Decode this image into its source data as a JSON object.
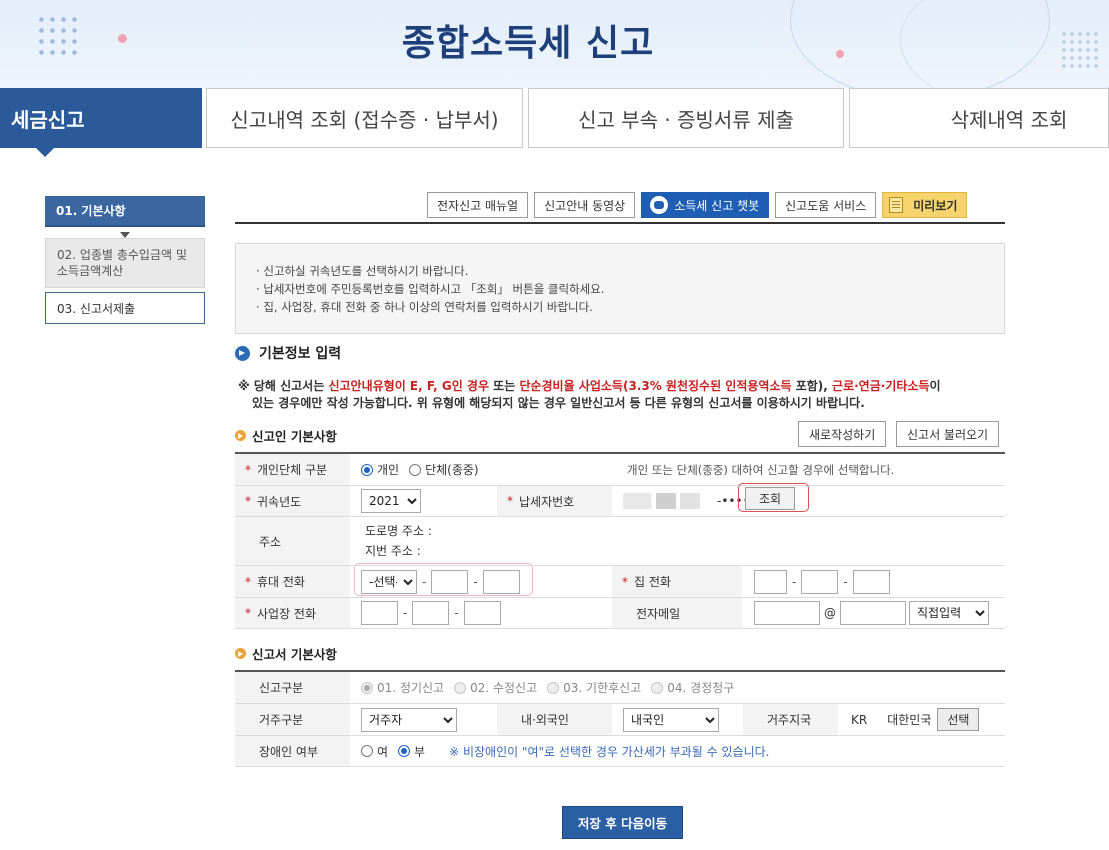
{
  "header": {
    "title": "종합소득세 신고"
  },
  "tabs": [
    {
      "label": "세금신고",
      "active": true
    },
    {
      "label": "신고내역 조회 (접수증 · 납부서)"
    },
    {
      "label": "신고 부속 · 증빙서류 제출"
    },
    {
      "label": "삭제내역 조회"
    }
  ],
  "steps": [
    {
      "label": "01. 기본사항"
    },
    {
      "label": "02. 업종별 총수입금액 및 소득금액계산"
    },
    {
      "label": "03. 신고서제출"
    }
  ],
  "toolbar": {
    "manual": "전자신고 매뉴얼",
    "video": "신고안내 동영상",
    "chatbot": "소득세 신고 챗봇",
    "help": "신고도움 서비스",
    "preview": "미리보기"
  },
  "notice": [
    "신고하실 귀속년도를 선택하시기 바랍니다.",
    "납세자번호에 주민등록번호를 입력하시고 「조회」 버튼을 클릭하세요.",
    "집, 사업장, 휴대 전화 중 하나 이상의 연락처를 입력하시기 바랍니다."
  ],
  "section_basic": "기본정보 입력",
  "warning": {
    "p1": "※ 당해 신고서는 ",
    "red1": "신고안내유형이 E, F, G인 경우",
    "p2": " 또는 ",
    "red2": "단순경비율 사업소득(3.3% 원천징수된 인적용역소득",
    "p3": " 포함), ",
    "red3": "근로·연금·기타소득",
    "p4": "이",
    "line2": "있는 경우에만 작성 가능합니다. 위 유형에 해당되지 않는 경우 일반신고서 등 다른 유형의 신고서를 이용하시기 바랍니다."
  },
  "filer": {
    "title": "신고인 기본사항",
    "new_button": "새로작성하기",
    "load_button": "신고서 불러오기",
    "type_label": "개인단체 구분",
    "type_personal": "개인",
    "type_group": "단체(종중)",
    "type_help": "개인 또는 단체(종중) 대하여 신고할 경우에 선택합니다.",
    "year_label": "귀속년도",
    "year_value": "2021",
    "taxpayer_label": "납세자번호",
    "taxpayer_masked": "-••••••",
    "lookup_button": "조회",
    "address_label": "주소",
    "road_address": "도로명 주소 :",
    "lot_address": "지번 주소 :",
    "mobile_label": "휴대 전화",
    "mobile_select": "-선택-",
    "home_label": "집 전화",
    "work_label": "사업장 전화",
    "email_label": "전자메일",
    "email_at": "@",
    "email_domain": "직접입력",
    "dash": "-"
  },
  "report": {
    "title": "신고서 기본사항",
    "kind_label": "신고구분",
    "kind_options": [
      "01. 정기신고",
      "02. 수정신고",
      "03. 기한후신고",
      "04. 경정청구"
    ],
    "residence_label": "거주구분",
    "residence_value": "거주자",
    "nationality_label": "내·외국인",
    "nationality_value": "내국인",
    "country_label": "거주지국",
    "country_code": "KR",
    "country_name": "대한민국",
    "country_button": "선택",
    "disabled_label": "장애인 여부",
    "disabled_yes": "여",
    "disabled_no": "부",
    "disabled_note": "※ 비장애인이 \"여\"로 선택한 경우 가산세가 부과될 수 있습니다."
  },
  "save_button": "저장 후 다음이동",
  "colors": {
    "primary": "#2a5a9a",
    "accent_red": "#c91f1f",
    "chatbot": "#1f5fb3",
    "preview": "#f6d36b"
  }
}
